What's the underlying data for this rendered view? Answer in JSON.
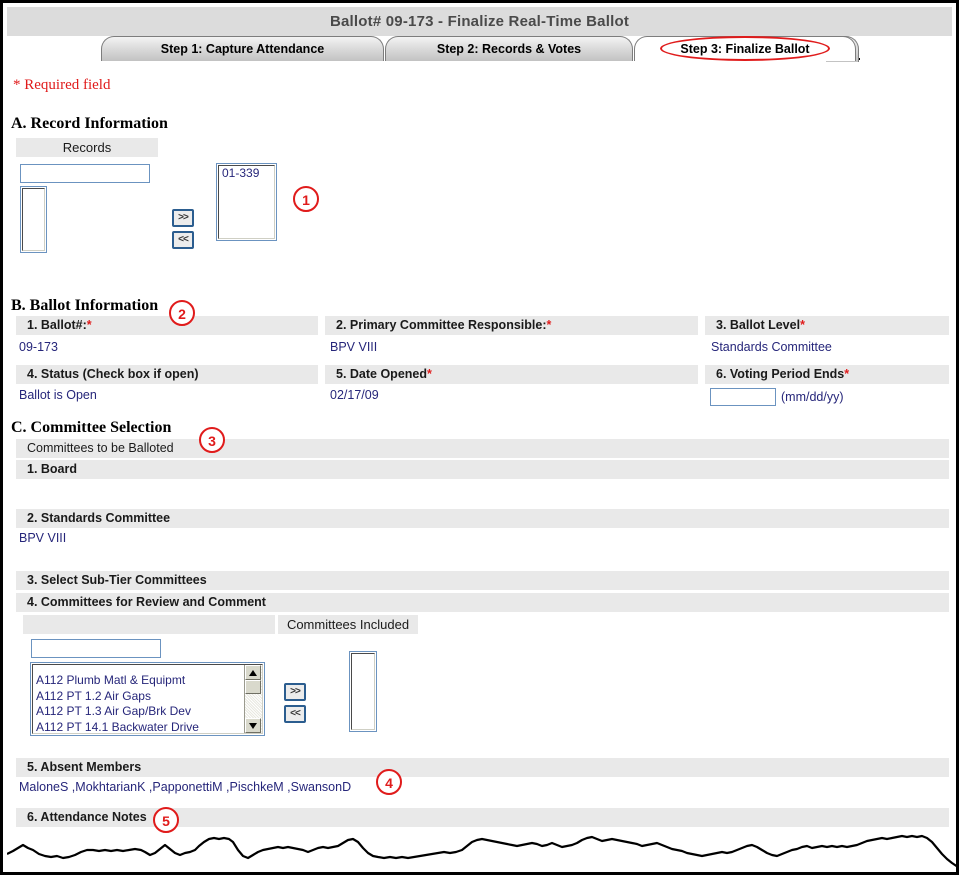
{
  "window": {
    "title": "Ballot# 09-173 - Finalize Real-Time Ballot"
  },
  "tabs": [
    {
      "label": "Step 1: Capture Attendance",
      "active": false
    },
    {
      "label": "Step 2: Records & Votes",
      "active": false
    },
    {
      "label": "Step 3: Finalize Ballot",
      "active": true
    }
  ],
  "required_note": "* Required field",
  "annotations": {
    "one": "1",
    "two": "2",
    "three": "3",
    "four": "4",
    "five": "5"
  },
  "colors": {
    "annotation_red": "#e01b1b",
    "label_bar_gray": "#e9e9e9",
    "title_bar_gray": "#dcdcdc",
    "value_blue": "#26267a",
    "input_border_blue": "#6b93c0"
  },
  "section_a": {
    "heading": "A. Record Information",
    "records_header": "Records",
    "search_value": "",
    "available_records": [],
    "selected_records": [
      "01-339"
    ],
    "add_button": ">>",
    "remove_button": "<<"
  },
  "section_b": {
    "heading": "B. Ballot Information",
    "fields": [
      {
        "label": "1. Ballot#:",
        "required": true,
        "value": "09-173"
      },
      {
        "label": "2. Primary Committee Responsible:",
        "required": true,
        "value": "BPV VIII"
      },
      {
        "label": "3. Ballot Level",
        "required": true,
        "value": "Standards Committee"
      },
      {
        "label": "4. Status (Check box if open)",
        "required": false,
        "value": "Ballot is Open"
      },
      {
        "label": "5. Date Opened",
        "required": true,
        "value": "02/17/09"
      },
      {
        "label": "6. Voting Period Ends",
        "required": true,
        "value": "",
        "hint": "(mm/dd/yy)"
      }
    ]
  },
  "section_c": {
    "heading": "C. Committee Selection",
    "balloted_header": "Committees to be Balloted",
    "rows": [
      {
        "label": "1. Board",
        "value": ""
      },
      {
        "label": "2. Standards Committee",
        "value": "BPV VIII"
      },
      {
        "label": "3. Select Sub-Tier Committees",
        "value": ""
      },
      {
        "label": "4. Committees for Review and Comment",
        "value": ""
      }
    ],
    "picker": {
      "left_header": "",
      "right_header": "Committees Included",
      "search_value": "",
      "available": [
        "A112 Plumb Matl & Equipmt",
        "A112 PT 1.2 Air Gaps",
        "A112 PT 1.3 Air Gap/Brk Dev",
        "A112 PT 14.1 Backwater Drive"
      ],
      "included": [],
      "add_button": ">>",
      "remove_button": "<<"
    },
    "absent_members": {
      "label": "5. Absent Members",
      "value": "MaloneS ,MokhtarianK ,PapponettiM ,PischkeM ,SwansonD"
    },
    "attendance_notes": {
      "label": "6. Attendance Notes",
      "value": ""
    }
  }
}
